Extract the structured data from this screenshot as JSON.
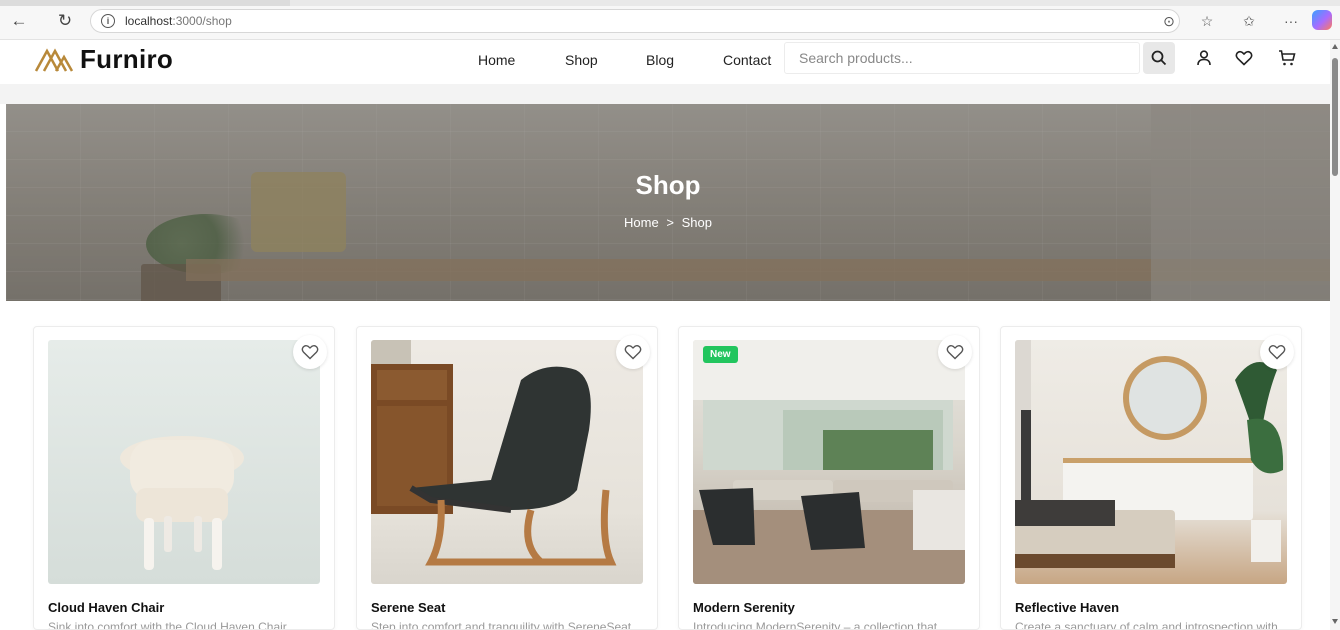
{
  "browser": {
    "url_host": "localhost",
    "url_path": ":3000/shop"
  },
  "header": {
    "logo_text": "Furniro",
    "menu": [
      "Home",
      "Shop",
      "Blog",
      "Contact"
    ],
    "search_placeholder": "Search products..."
  },
  "hero": {
    "title": "Shop",
    "breadcrumb": [
      "Home",
      ">",
      "Shop"
    ]
  },
  "products": [
    {
      "name": "Cloud Haven Chair",
      "description": "Sink into comfort with the Cloud Haven Chair...",
      "badge": ""
    },
    {
      "name": "Serene Seat",
      "description": "Step into comfort and tranquility with SereneSeat...",
      "badge": ""
    },
    {
      "name": "Modern Serenity",
      "description": "Introducing ModernSerenity – a collection that...",
      "badge": "New"
    },
    {
      "name": "Reflective Haven",
      "description": "Create a sanctuary of calm and introspection with...",
      "badge": ""
    }
  ],
  "colors": {
    "brand_gold": "#b8893a",
    "badge_new": "#22c55e"
  }
}
